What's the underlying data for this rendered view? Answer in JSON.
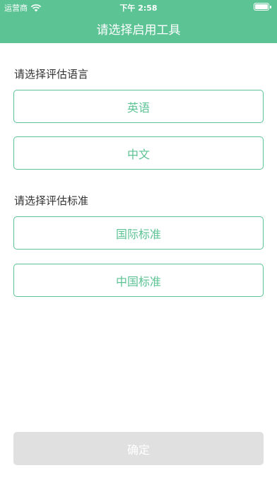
{
  "status_bar": {
    "carrier": "运营商",
    "time": "下午 2:58",
    "wifi_icon": "wifi-icon",
    "battery_icon": "battery-icon"
  },
  "nav": {
    "title": "请选择启用工具"
  },
  "language_section": {
    "label": "请选择评估语言",
    "options": [
      "英语",
      "中文"
    ]
  },
  "standard_section": {
    "label": "请选择评估标准",
    "options": [
      "国际标准",
      "中国标准"
    ]
  },
  "confirm_button": {
    "label": "确定",
    "state": "disabled"
  },
  "colors": {
    "accent": "#5cc394",
    "disabled": "#e0e0e0"
  }
}
